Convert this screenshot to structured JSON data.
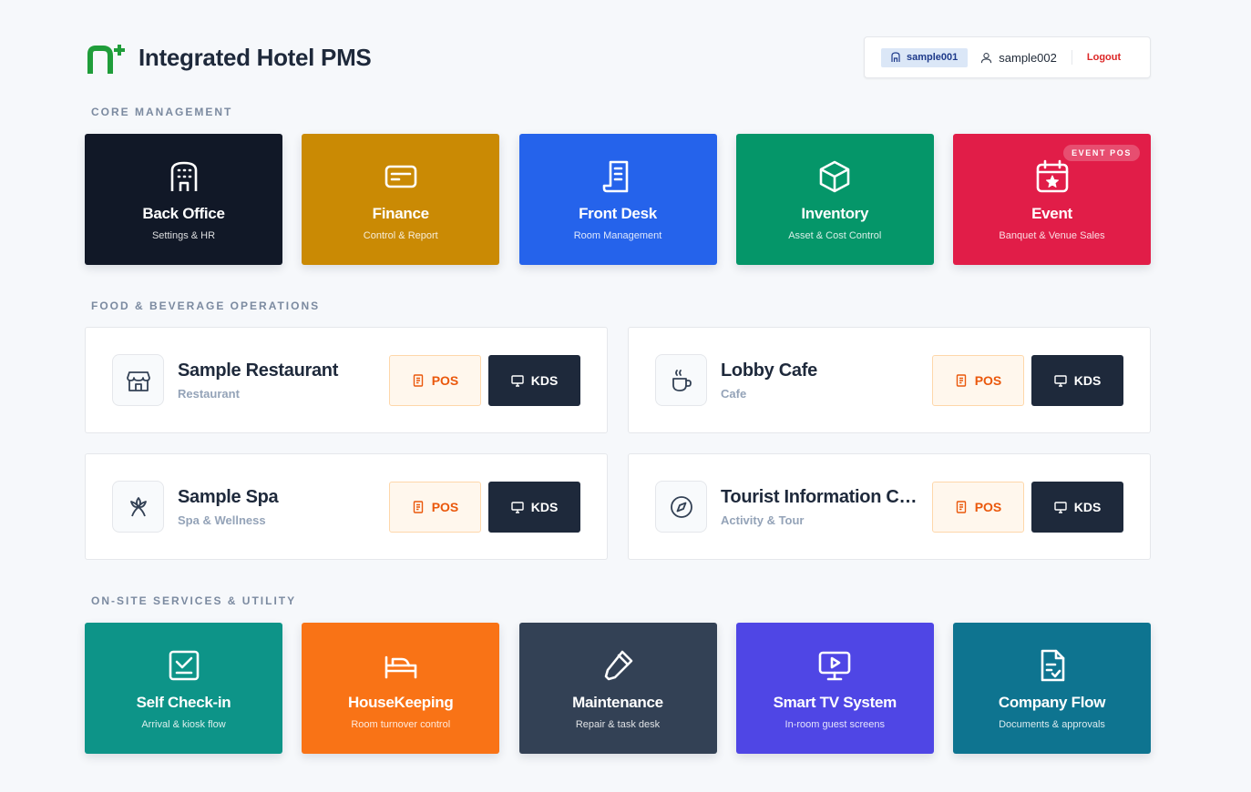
{
  "brand": {
    "title": "Integrated Hotel PMS",
    "logo_color": "#1f9d3a"
  },
  "user": {
    "property": "sample001",
    "username": "sample002",
    "logout": "Logout"
  },
  "sections": {
    "core": "CORE MANAGEMENT",
    "fb": "FOOD & BEVERAGE OPERATIONS",
    "onsite": "ON-SITE SERVICES & UTILITY"
  },
  "core_tiles": [
    {
      "title": "Back Office",
      "sub": "Settings & HR",
      "color": "#111827",
      "icon": "building-icon"
    },
    {
      "title": "Finance",
      "sub": "Control & Report",
      "color": "#ca8a04",
      "icon": "credit-card-icon"
    },
    {
      "title": "Front Desk",
      "sub": "Room Management",
      "color": "#2563eb",
      "icon": "receipt-icon"
    },
    {
      "title": "Inventory",
      "sub": "Asset & Cost Control",
      "color": "#059669",
      "icon": "box-icon"
    },
    {
      "title": "Event",
      "sub": "Banquet & Venue Sales",
      "color": "#e11d48",
      "icon": "calendar-star-icon",
      "badge": "EVENT POS"
    }
  ],
  "outlets": [
    {
      "name": "Sample Restaurant",
      "type": "Restaurant",
      "icon": "store-icon"
    },
    {
      "name": "Lobby Cafe",
      "type": "Cafe",
      "icon": "coffee-icon"
    },
    {
      "name": "Sample Spa",
      "type": "Spa & Wellness",
      "icon": "flower-icon"
    },
    {
      "name": "Tourist Information Center",
      "type": "Activity & Tour",
      "icon": "compass-icon"
    }
  ],
  "outlet_buttons": {
    "pos": "POS",
    "kds": "KDS"
  },
  "onsite_tiles": [
    {
      "title": "Self Check-in",
      "sub": "Arrival & kiosk flow",
      "color": "#0d9488",
      "icon": "checkbox-icon"
    },
    {
      "title": "HouseKeeping",
      "sub": "Room turnover control",
      "color": "#f97316",
      "icon": "bed-icon"
    },
    {
      "title": "Maintenance",
      "sub": "Repair & task desk",
      "color": "#334155",
      "icon": "wrench-icon"
    },
    {
      "title": "Smart TV System",
      "sub": "In-room guest screens",
      "color": "#4f46e5",
      "icon": "tv-play-icon"
    },
    {
      "title": "Company Flow",
      "sub": "Documents & approvals",
      "color": "#0e7490",
      "icon": "file-check-icon"
    }
  ]
}
